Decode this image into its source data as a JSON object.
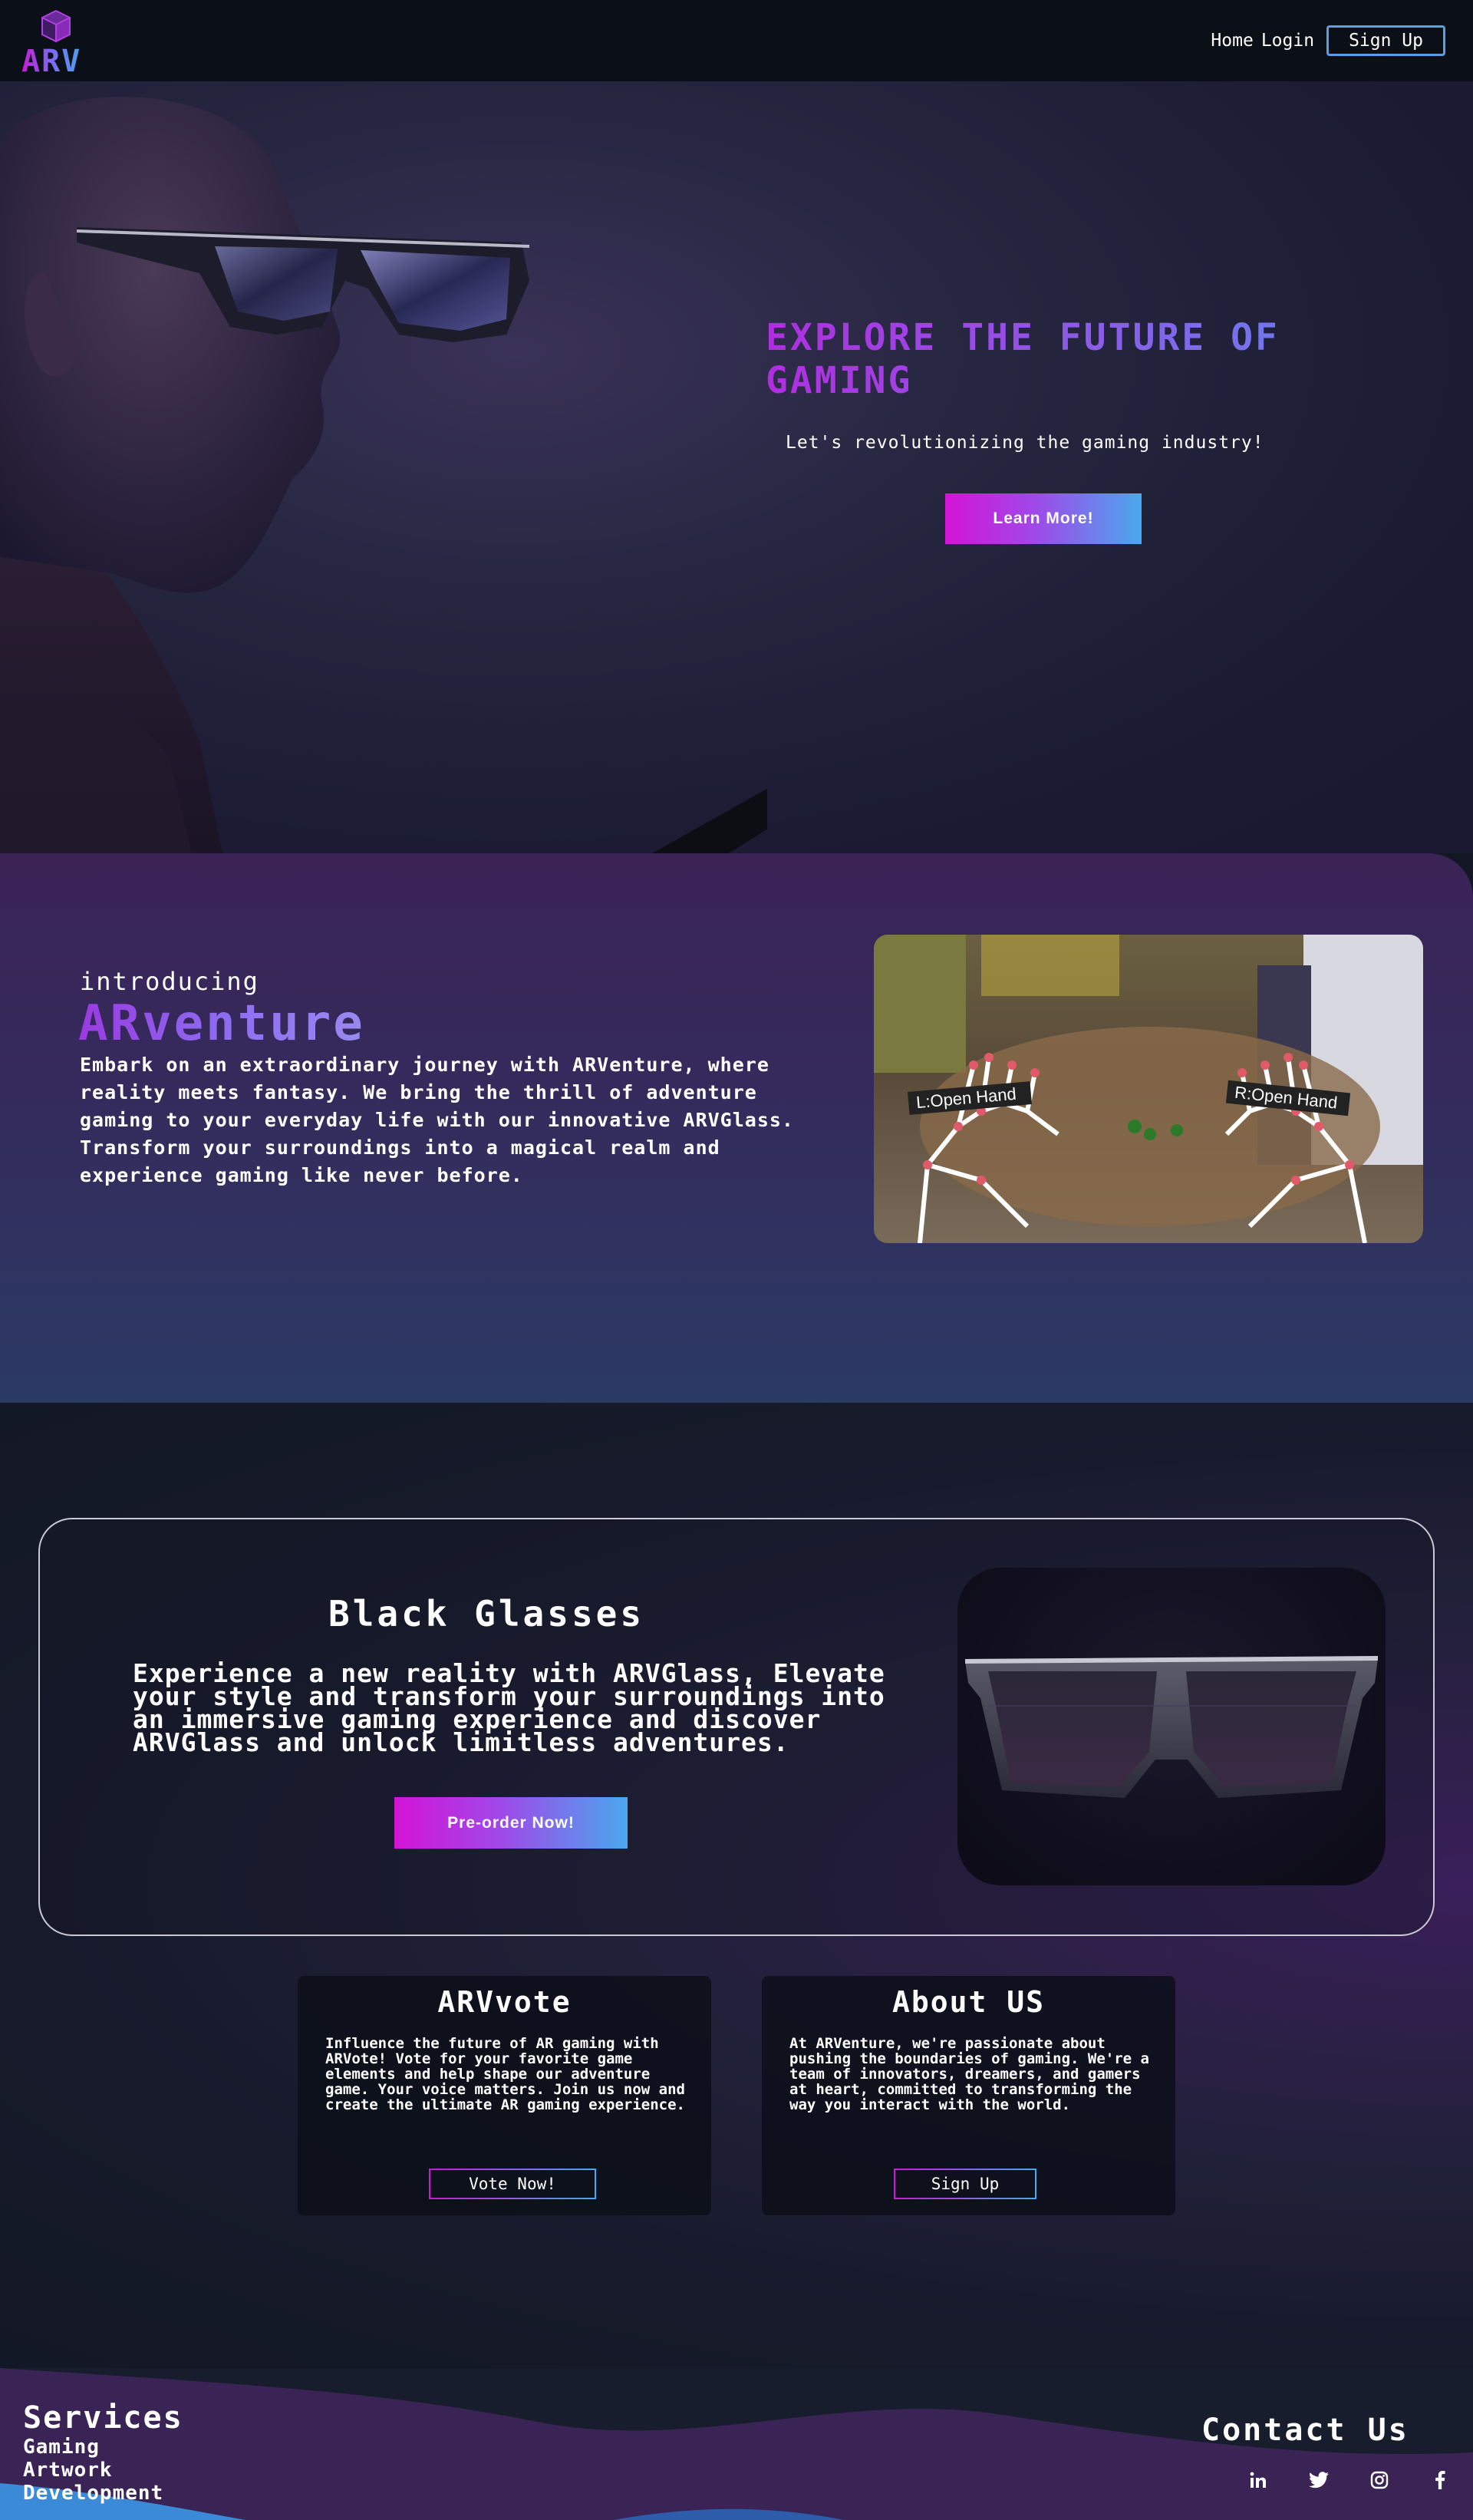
{
  "nav": {
    "logo_text": "ARV",
    "links": [
      "Home",
      "Login"
    ],
    "signup": "Sign Up"
  },
  "hero": {
    "title": "EXPLORE THE FUTURE OF GAMING",
    "subtitle": "Let's revolutionizing the gaming industry!",
    "button": "Learn More!"
  },
  "intro": {
    "kicker": "introducing",
    "brand": "ARventure",
    "text": "Embark on an extraordinary journey with ARVenture, where reality meets fantasy. We bring the thrill of adventure gaming to your everyday life with our innovative ARVGlass. Transform your surroundings into a magical realm and experience gaming like never before.",
    "image_labels": [
      "L:Open Hand",
      "R:Open Hand"
    ]
  },
  "product": {
    "title": "Black Glasses",
    "text": "Experience a new reality with ARVGlass, Elevate your style and transform your surroundings into an immersive gaming experience and discover ARVGlass and unlock limitless adventures.",
    "button": "Pre-order Now!"
  },
  "vote": {
    "title": "ARVvote",
    "text": "Influence the future of AR gaming with ARVote! Vote for your favorite game elements and help shape our adventure game. Your voice matters. Join us now and create the ultimate AR gaming experience.",
    "button": "Vote Now!"
  },
  "about": {
    "title": "About US",
    "text": "At ARVenture, we're passionate about pushing the boundaries of gaming. We're a team of innovators, dreamers, and gamers at heart, committed to transforming the way you interact with the world.",
    "button": "Sign Up"
  },
  "footer": {
    "services_title": "Services",
    "services": [
      "Gaming",
      "Artwork",
      "Development"
    ],
    "contact_title": "Contact Us",
    "socials": [
      "linkedin-icon",
      "twitter-icon",
      "instagram-icon",
      "facebook-icon"
    ]
  },
  "colors": {
    "accent_magenta": "#d414d6",
    "accent_blue": "#4aa8ee",
    "nav_bg": "#0b0f17"
  }
}
